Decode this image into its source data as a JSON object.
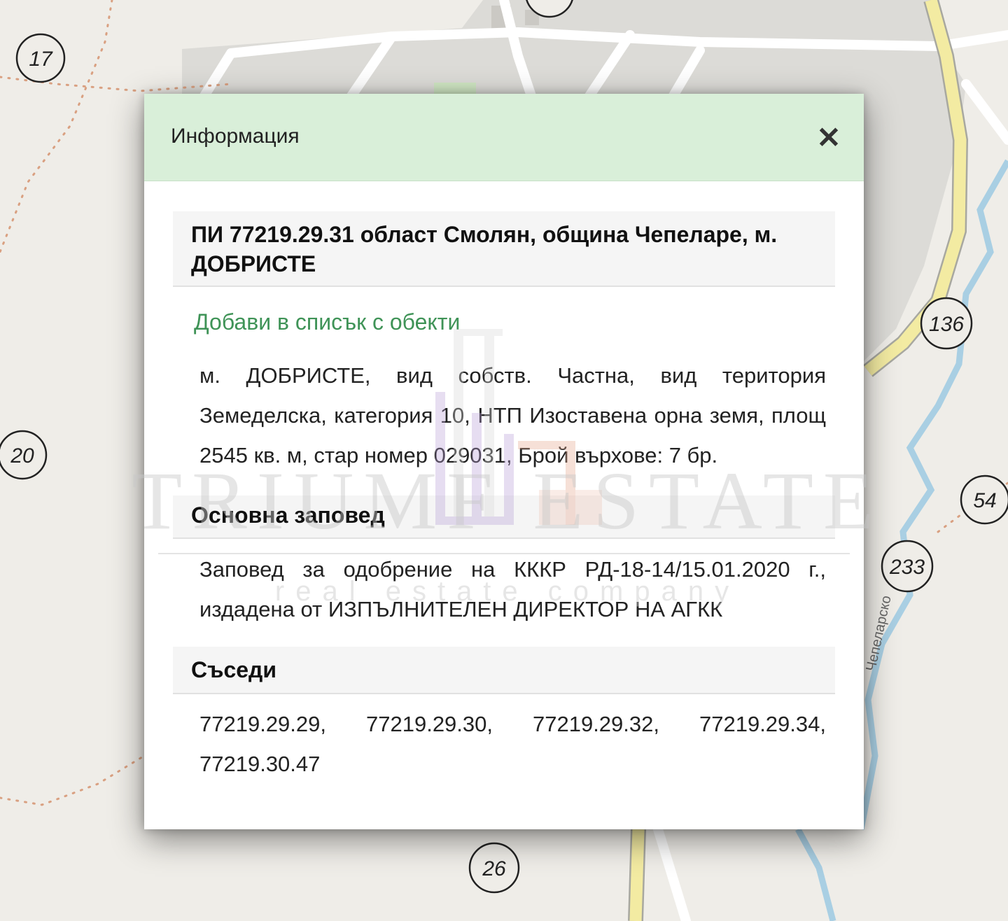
{
  "map": {
    "markers": [
      "17",
      "20",
      "136",
      "54",
      "233",
      "26"
    ],
    "street_label": "Чепеларско",
    "colors": {
      "background": "#efede8",
      "road": "#ffffff",
      "main_road": "#f3eba2",
      "river": "#a9cfe3",
      "trail": "#d9a081",
      "built_area": "#dcdbd7",
      "park": "#cfe6c3"
    }
  },
  "dialog": {
    "title": "Информация",
    "close_icon": "close-icon",
    "parcel_title": "ПИ 77219.29.31 област Смолян, община Чепеларе, м. ДОБРИСТЕ",
    "add_link": "Добави в списък с обекти",
    "description": "м. ДОБРИСТЕ, вид собств. Частна, вид територия Земеделска, категория 10, НТП Изоставена орна земя, площ 2545 кв. м, стар номер 029031, Брой върхове: 7 бр.",
    "order_heading": "Основна заповед",
    "order_text": "Заповед за одобрение на КККР РД-18-14/15.01.2020 г., издадена от ИЗПЪЛНИТЕЛЕН ДИРЕКТОР НА АГКК",
    "neighbors_heading": "Съседи",
    "neighbors_text": "77219.29.29, 77219.29.30, 77219.29.32, 77219.29.34, 77219.30.47",
    "colors": {
      "header_bg": "#d9efd9",
      "link": "#3f9357",
      "section_bg": "#f5f5f5"
    }
  },
  "watermark": {
    "brand": "TRIUMF ESTATE",
    "tagline": "real estate company"
  }
}
